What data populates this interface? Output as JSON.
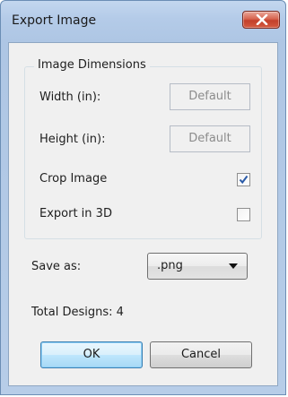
{
  "window": {
    "title": "Export Image"
  },
  "dimensions": {
    "group_title": "Image Dimensions",
    "width_label": "Width (in):",
    "width_value": "Default",
    "height_label": "Height (in):",
    "height_value": "Default",
    "crop_label": "Crop Image",
    "crop_checked": true,
    "export3d_label": "Export in 3D",
    "export3d_checked": false
  },
  "save": {
    "label": "Save as:",
    "format_value": ".png"
  },
  "summary": {
    "total_designs": "Total Designs: 4"
  },
  "buttons": {
    "ok_label": "OK",
    "cancel_label": "Cancel"
  },
  "colors": {
    "accent": "#3c7fb1",
    "close_red": "#c3402b",
    "check_blue": "#2a5aa8"
  },
  "icons": {
    "close": "close-icon",
    "check": "checkmark-icon",
    "dropdown": "chevron-down-icon"
  }
}
